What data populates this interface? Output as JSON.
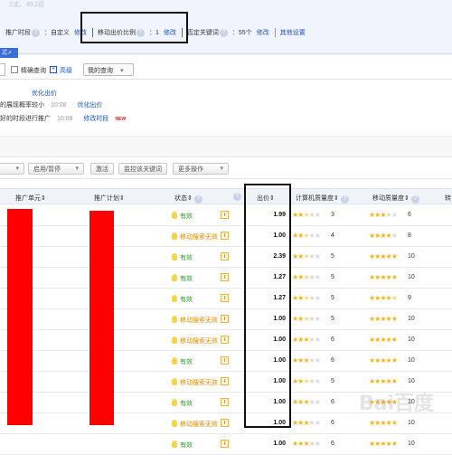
{
  "campaign": {
    "top_faded_text": "Ξ北、40.2百",
    "time_label": "推广时段",
    "time_value": "：自定义",
    "time_edit": "修改",
    "mobile_ratio_label": "移动出价比例",
    "mobile_ratio_value": "：1",
    "mobile_ratio_edit": "修改",
    "negative_label": "否定关键词",
    "negative_value": "：55个",
    "negative_edit": "修改",
    "other_settings": "其他设置",
    "blue_button": "式"
  },
  "search": {
    "exact_label": "精确查询",
    "advanced_label": "高级",
    "my_query_label": "我的查询"
  },
  "suggestions": {
    "title": "优化出价",
    "line1_text": "的展现概率较小",
    "line1_time": "10:08",
    "line1_action": "优化出价",
    "line2_text": "好的时段进行推广",
    "line2_time": "10:08",
    "line2_action": "修改时段",
    "line2_badge": "NEW"
  },
  "toolbar": {
    "enable_pause": "启用/暂停",
    "activate": "激活",
    "monitor_keyword": "监控该关键词",
    "more_actions": "更多操作"
  },
  "table": {
    "headers": {
      "unit": "推广单元",
      "plan": "推广计划",
      "status": "状态",
      "price": "出价",
      "pc_quality": "计算机质量度",
      "mobile_quality": "移动质量度",
      "next": "转"
    },
    "rows": [
      {
        "status": "有效",
        "status_type": "ok",
        "price": "1.99",
        "pc_stars": 2.5,
        "pc_score": "3",
        "mob_stars": 3,
        "mob_score": "6"
      },
      {
        "status": "移动搜索无效",
        "status_type": "warn",
        "price": "1.00",
        "pc_stars": 2.5,
        "pc_score": "4",
        "mob_stars": 4,
        "mob_score": "8"
      },
      {
        "status": "有效",
        "status_type": "ok",
        "price": "2.39",
        "pc_stars": 2.5,
        "pc_score": "5",
        "mob_stars": 5,
        "mob_score": "10"
      },
      {
        "status": "有效",
        "status_type": "ok",
        "price": "1.27",
        "pc_stars": 2.5,
        "pc_score": "5",
        "mob_stars": 5,
        "mob_score": "10"
      },
      {
        "status": "有效",
        "status_type": "ok",
        "price": "1.27",
        "pc_stars": 2.5,
        "pc_score": "5",
        "mob_stars": 4.5,
        "mob_score": "9"
      },
      {
        "status": "移动搜索无效",
        "status_type": "warn",
        "price": "1.00",
        "pc_stars": 2.5,
        "pc_score": "5",
        "mob_stars": 5,
        "mob_score": "10"
      },
      {
        "status": "移动搜索无效",
        "status_type": "warn",
        "price": "1.00",
        "pc_stars": 3,
        "pc_score": "6",
        "mob_stars": 5,
        "mob_score": "10"
      },
      {
        "status": "有效",
        "status_type": "ok",
        "price": "1.00",
        "pc_stars": 3,
        "pc_score": "6",
        "mob_stars": 5,
        "mob_score": "10"
      },
      {
        "status": "移动搜索无效",
        "status_type": "warn",
        "price": "1.00",
        "pc_stars": 2.5,
        "pc_score": "5",
        "mob_stars": 5,
        "mob_score": "10"
      },
      {
        "status": "有效",
        "status_type": "ok",
        "price": "1.00",
        "pc_stars": 3,
        "pc_score": "6",
        "mob_stars": 5,
        "mob_score": "10"
      },
      {
        "status": "移动搜索无效",
        "status_type": "warn",
        "price": "1.00",
        "pc_stars": 3,
        "pc_score": "6",
        "mob_stars": 5,
        "mob_score": "10"
      },
      {
        "status": "有效",
        "status_type": "ok",
        "price": "1.00",
        "pc_stars": 3,
        "pc_score": "6",
        "mob_stars": 5,
        "mob_score": "10"
      }
    ]
  },
  "watermark": "Bai百度",
  "colors": {
    "link": "#1a54c4",
    "ok": "#2f9a2f",
    "warn": "#e08a00",
    "star": "#f1b51c",
    "redact": "#ff0000"
  }
}
